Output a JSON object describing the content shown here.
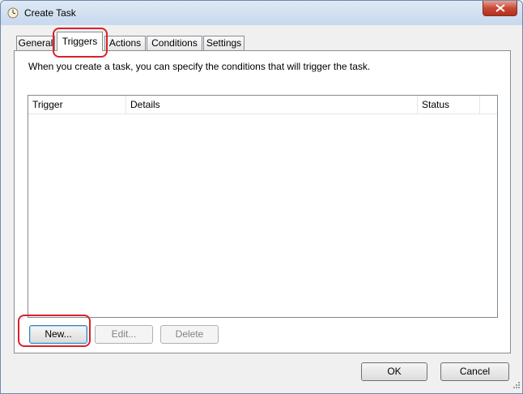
{
  "window": {
    "title": "Create Task"
  },
  "tabs": [
    {
      "label": "General"
    },
    {
      "label": "Triggers",
      "active": true
    },
    {
      "label": "Actions"
    },
    {
      "label": "Conditions"
    },
    {
      "label": "Settings"
    }
  ],
  "triggers_panel": {
    "description": "When you create a task, you can specify the conditions that will trigger the task.",
    "columns": [
      "Trigger",
      "Details",
      "Status"
    ],
    "rows": []
  },
  "panel_buttons": {
    "new_label": "New...",
    "edit_label": "Edit...",
    "delete_label": "Delete"
  },
  "footer": {
    "ok_label": "OK",
    "cancel_label": "Cancel"
  },
  "colors": {
    "annotation": "#d8222a",
    "close_button": "#c74a36"
  }
}
